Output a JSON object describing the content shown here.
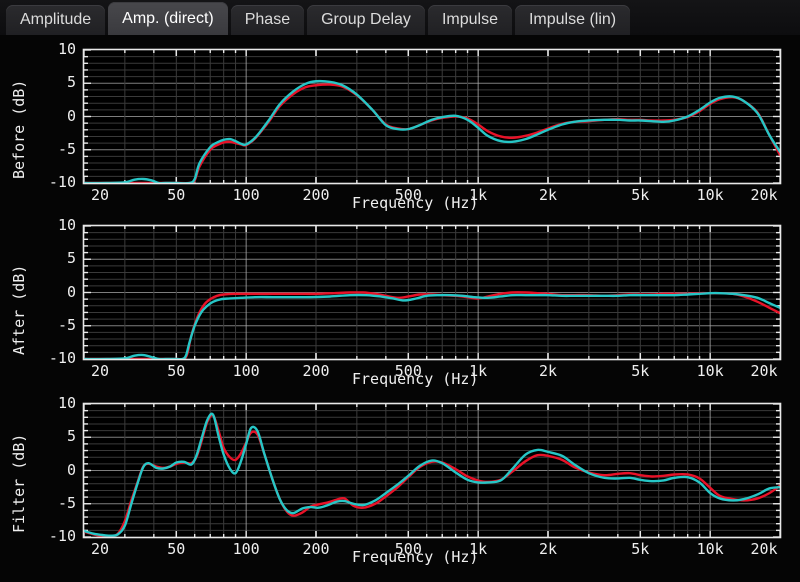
{
  "tabs": [
    {
      "label": "Amplitude",
      "active": false
    },
    {
      "label": "Amp. (direct)",
      "active": true
    },
    {
      "label": "Phase",
      "active": false
    },
    {
      "label": "Group Delay",
      "active": false
    },
    {
      "label": "Impulse",
      "active": false
    },
    {
      "label": "Impulse (lin)",
      "active": false
    }
  ],
  "colors": {
    "series_left": "#e81228",
    "series_right": "#26c6c6",
    "axis": "#e8e8e8",
    "grid_major": "#a8a8a8",
    "grid_minor": "#3a3a3a",
    "background": "#000000",
    "tab_active": "#3f3f43",
    "tab_inactive": "#242427",
    "text": "#efefef"
  },
  "axes": {
    "x_label": "Frequency (Hz)",
    "x_ticks": [
      "20",
      "50",
      "100",
      "200",
      "500",
      "1k",
      "2k",
      "5k",
      "10k",
      "20k"
    ],
    "x_tick_values": [
      20,
      50,
      100,
      200,
      500,
      1000,
      2000,
      5000,
      10000,
      20000
    ],
    "x_min": 20,
    "x_max": 20000,
    "y_ticks": [
      "10",
      "5",
      "0",
      "-5",
      "-10"
    ],
    "y_tick_values": [
      10,
      5,
      0,
      -5,
      -10
    ],
    "y_min": -10,
    "y_max": 10,
    "y_unit": "dB",
    "scale": "log-x"
  },
  "chart_data": [
    {
      "type": "line",
      "title": "Before",
      "ylabel": "Before (dB)",
      "xlabel": "Frequency (Hz)",
      "xscale": "log",
      "xlim": [
        20,
        20000
      ],
      "ylim": [
        -10,
        10
      ],
      "grid": true,
      "legend": "none",
      "series": [
        {
          "name": "left",
          "color": "#e81228",
          "x": [
            20,
            25,
            32,
            40,
            50,
            57,
            60,
            63,
            70,
            75,
            80,
            85,
            90,
            95,
            100,
            110,
            125,
            140,
            160,
            180,
            200,
            230,
            260,
            300,
            350,
            400,
            450,
            500,
            560,
            630,
            700,
            800,
            900,
            1000,
            1100,
            1250,
            1400,
            1600,
            1800,
            2000,
            2300,
            2600,
            3000,
            3500,
            4000,
            4500,
            5000,
            5600,
            6300,
            7000,
            8000,
            9000,
            10000,
            11000,
            12500,
            14000,
            16000,
            18000,
            20000
          ],
          "values": [
            -10,
            -10,
            -10,
            -10,
            -10,
            -10,
            -9.6,
            -7.5,
            -5.0,
            -4.3,
            -3.9,
            -3.8,
            -4.0,
            -4.2,
            -4.3,
            -3.2,
            -0.8,
            1.6,
            3.4,
            4.4,
            4.7,
            4.8,
            4.5,
            3.2,
            1.0,
            -1.2,
            -1.8,
            -1.9,
            -1.3,
            -0.6,
            -0.2,
            0.0,
            -0.3,
            -1.2,
            -2.2,
            -3.0,
            -3.2,
            -2.9,
            -2.4,
            -1.8,
            -1.1,
            -0.8,
            -0.7,
            -0.5,
            -0.4,
            -0.5,
            -0.5,
            -0.6,
            -0.6,
            -0.5,
            -0.1,
            0.8,
            1.9,
            2.6,
            2.9,
            2.3,
            0.6,
            -2.8,
            -5.8
          ]
        },
        {
          "name": "right",
          "color": "#26c6c6",
          "x": [
            20,
            25,
            30,
            33,
            36,
            39,
            42,
            45,
            50,
            57,
            60,
            63,
            70,
            75,
            80,
            85,
            90,
            95,
            100,
            110,
            125,
            140,
            160,
            180,
            200,
            230,
            260,
            300,
            350,
            400,
            450,
            500,
            560,
            630,
            700,
            800,
            900,
            1000,
            1100,
            1250,
            1400,
            1600,
            1800,
            2000,
            2300,
            2600,
            3000,
            3500,
            4000,
            4500,
            5000,
            5600,
            6300,
            7000,
            8000,
            9000,
            10000,
            11000,
            12500,
            14000,
            16000,
            18000,
            20000
          ],
          "values": [
            -10,
            -10,
            -9.9,
            -9.5,
            -9.4,
            -9.6,
            -10,
            -10,
            -10,
            -10,
            -9.4,
            -7.0,
            -4.6,
            -3.9,
            -3.5,
            -3.4,
            -3.7,
            -4.1,
            -4.2,
            -3.1,
            -0.6,
            1.9,
            3.8,
            4.9,
            5.3,
            5.2,
            4.7,
            3.3,
            1.0,
            -1.3,
            -1.9,
            -1.9,
            -1.3,
            -0.5,
            -0.1,
            0.1,
            -0.5,
            -1.7,
            -2.9,
            -3.7,
            -3.8,
            -3.4,
            -2.7,
            -2.0,
            -1.2,
            -0.8,
            -0.6,
            -0.5,
            -0.5,
            -0.6,
            -0.6,
            -0.7,
            -0.8,
            -0.6,
            0.0,
            1.0,
            2.1,
            2.8,
            3.0,
            2.3,
            0.5,
            -2.8,
            -5.3
          ]
        }
      ]
    },
    {
      "type": "line",
      "title": "After",
      "ylabel": "After (dB)",
      "xlabel": "Frequency (Hz)",
      "xscale": "log",
      "xlim": [
        20,
        20000
      ],
      "ylim": [
        -10,
        10
      ],
      "grid": true,
      "legend": "none",
      "series": [
        {
          "name": "left",
          "color": "#e81228",
          "x": [
            20,
            30,
            40,
            50,
            54,
            56,
            58,
            62,
            66,
            70,
            75,
            80,
            90,
            100,
            120,
            140,
            170,
            200,
            240,
            280,
            320,
            360,
            400,
            450,
            500,
            560,
            630,
            700,
            800,
            900,
            1000,
            1100,
            1250,
            1400,
            1600,
            1800,
            2000,
            2300,
            2600,
            3000,
            3500,
            4000,
            4500,
            5000,
            5600,
            6300,
            7000,
            8000,
            9000,
            10000,
            11000,
            12500,
            14000,
            16000,
            18000,
            20000
          ],
          "values": [
            -10,
            -10,
            -10,
            -10,
            -10,
            -9.0,
            -6.5,
            -3.5,
            -1.8,
            -1.0,
            -0.5,
            -0.3,
            -0.2,
            -0.2,
            -0.2,
            -0.2,
            -0.2,
            -0.2,
            -0.1,
            0.0,
            0.0,
            -0.2,
            -0.5,
            -0.8,
            -0.6,
            -0.3,
            -0.3,
            -0.4,
            -0.5,
            -0.7,
            -0.9,
            -0.6,
            -0.2,
            0.0,
            0.0,
            -0.1,
            -0.2,
            -0.4,
            -0.4,
            -0.4,
            -0.5,
            -0.4,
            -0.3,
            -0.3,
            -0.3,
            -0.2,
            -0.2,
            -0.2,
            -0.1,
            -0.1,
            -0.1,
            -0.2,
            -0.6,
            -1.4,
            -2.3,
            -3.1
          ]
        },
        {
          "name": "right",
          "color": "#26c6c6",
          "x": [
            20,
            25,
            30,
            33,
            36,
            39,
            42,
            45,
            50,
            53,
            55,
            57,
            60,
            64,
            68,
            72,
            78,
            85,
            95,
            110,
            130,
            160,
            190,
            230,
            280,
            330,
            380,
            430,
            480,
            540,
            600,
            680,
            760,
            860,
            960,
            1100,
            1250,
            1400,
            1600,
            1800,
            2000,
            2300,
            2600,
            3000,
            3500,
            4000,
            4500,
            5000,
            5600,
            6300,
            7000,
            8000,
            9000,
            10000,
            11000,
            12500,
            14000,
            16000,
            18000,
            20000
          ],
          "values": [
            -10,
            -10,
            -9.9,
            -9.5,
            -9.4,
            -9.7,
            -10,
            -10,
            -10,
            -10,
            -9.5,
            -7.5,
            -5.0,
            -3.0,
            -2.0,
            -1.4,
            -1.0,
            -0.9,
            -0.8,
            -0.7,
            -0.7,
            -0.7,
            -0.7,
            -0.6,
            -0.4,
            -0.4,
            -0.6,
            -0.9,
            -1.2,
            -0.9,
            -0.5,
            -0.4,
            -0.4,
            -0.5,
            -0.7,
            -0.8,
            -0.6,
            -0.4,
            -0.4,
            -0.4,
            -0.4,
            -0.5,
            -0.5,
            -0.5,
            -0.5,
            -0.5,
            -0.4,
            -0.4,
            -0.4,
            -0.4,
            -0.4,
            -0.3,
            -0.2,
            -0.1,
            -0.1,
            -0.2,
            -0.4,
            -0.8,
            -1.6,
            -2.3
          ]
        }
      ]
    },
    {
      "type": "line",
      "title": "Filter",
      "ylabel": "Filter (dB)",
      "xlabel": "Frequency (Hz)",
      "xscale": "log",
      "xlim": [
        20,
        20000
      ],
      "ylim": [
        -10,
        10
      ],
      "grid": true,
      "legend": "none",
      "series": [
        {
          "name": "left",
          "color": "#e81228",
          "x": [
            20,
            22,
            24,
            26,
            28,
            30,
            32,
            34,
            36,
            38,
            41,
            44,
            47,
            50,
            54,
            58,
            61,
            64,
            68,
            72,
            76,
            80,
            85,
            90,
            95,
            100,
            105,
            112,
            120,
            130,
            140,
            150,
            160,
            175,
            190,
            205,
            225,
            245,
            265,
            290,
            320,
            360,
            400,
            450,
            500,
            560,
            630,
            700,
            800,
            900,
            1000,
            1100,
            1250,
            1400,
            1600,
            1800,
            2000,
            2300,
            2600,
            3000,
            3500,
            4000,
            4500,
            5000,
            5600,
            6300,
            7000,
            8000,
            9000,
            10000,
            11000,
            12500,
            14000,
            16000,
            18000,
            20000
          ],
          "values": [
            -9.2,
            -9.6,
            -9.9,
            -9.9,
            -9.5,
            -7.6,
            -4.5,
            -1.8,
            0.6,
            1.0,
            0.6,
            0.4,
            0.6,
            1.0,
            1.2,
            1.1,
            2.0,
            4.2,
            7.3,
            8.3,
            6.0,
            3.4,
            2.0,
            1.6,
            2.6,
            4.2,
            5.7,
            5.4,
            2.4,
            -1.4,
            -4.4,
            -6.2,
            -6.8,
            -6.3,
            -5.4,
            -5.1,
            -4.8,
            -4.4,
            -4.2,
            -5.3,
            -5.6,
            -5.0,
            -3.9,
            -2.5,
            -1.0,
            0.5,
            1.3,
            1.2,
            0.2,
            -0.9,
            -1.5,
            -1.7,
            -1.4,
            -0.2,
            1.4,
            2.3,
            2.2,
            1.6,
            0.5,
            -0.3,
            -0.7,
            -0.5,
            -0.4,
            -0.7,
            -0.9,
            -0.8,
            -0.6,
            -0.6,
            -1.2,
            -2.6,
            -3.8,
            -4.3,
            -4.5,
            -4.2,
            -3.4,
            -2.3,
            -3.0
          ]
        },
        {
          "name": "right",
          "color": "#26c6c6",
          "x": [
            20,
            22,
            24,
            26,
            28,
            30,
            32,
            34,
            36,
            38,
            41,
            44,
            47,
            50,
            54,
            58,
            61,
            64,
            68,
            72,
            76,
            80,
            85,
            90,
            95,
            100,
            105,
            112,
            120,
            130,
            140,
            150,
            160,
            175,
            190,
            205,
            225,
            245,
            265,
            290,
            320,
            360,
            400,
            450,
            500,
            560,
            630,
            700,
            800,
            900,
            1000,
            1100,
            1250,
            1400,
            1600,
            1800,
            2000,
            2300,
            2600,
            3000,
            3500,
            4000,
            4500,
            5000,
            5600,
            6300,
            7000,
            8000,
            9000,
            10000,
            11000,
            12500,
            14000,
            16000,
            18000,
            20000
          ],
          "values": [
            -9.1,
            -9.5,
            -9.7,
            -9.8,
            -9.6,
            -8.3,
            -5.0,
            -2.0,
            0.5,
            1.1,
            0.4,
            0.3,
            0.6,
            1.2,
            1.3,
            0.9,
            2.2,
            4.6,
            7.6,
            8.4,
            5.2,
            2.4,
            0.3,
            -0.4,
            1.4,
            4.0,
            6.4,
            5.9,
            2.4,
            -1.4,
            -4.4,
            -6.0,
            -6.4,
            -5.7,
            -5.5,
            -5.6,
            -5.2,
            -4.7,
            -4.6,
            -5.0,
            -5.2,
            -4.5,
            -3.4,
            -2.1,
            -0.8,
            0.7,
            1.5,
            1.1,
            -0.3,
            -1.4,
            -1.8,
            -1.8,
            -1.5,
            0.2,
            2.4,
            3.1,
            2.8,
            2.2,
            0.9,
            -0.4,
            -1.1,
            -1.2,
            -1.1,
            -1.4,
            -1.6,
            -1.5,
            -1.1,
            -1.0,
            -1.8,
            -3.4,
            -4.2,
            -4.5,
            -4.3,
            -3.6,
            -2.7,
            -2.5,
            -3.3
          ]
        }
      ]
    }
  ]
}
